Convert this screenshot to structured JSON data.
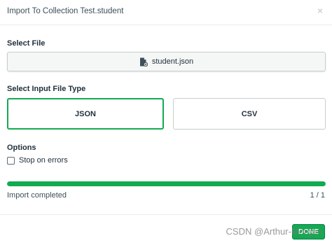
{
  "dialog": {
    "title": "Import To Collection Test.student",
    "close_icon": "×"
  },
  "select_file": {
    "label": "Select File",
    "file_name": "student.json",
    "icon": "file-icon"
  },
  "file_type": {
    "label": "Select Input File Type",
    "options": [
      {
        "label": "JSON",
        "selected": true
      },
      {
        "label": "CSV",
        "selected": false
      }
    ],
    "selected_color": "#13aa52"
  },
  "options": {
    "label": "Options",
    "stop_on_errors": {
      "label": "Stop on errors",
      "checked": false
    }
  },
  "progress": {
    "fraction": 1.0,
    "status": "Import completed",
    "count": "1 / 1",
    "color": "#13aa52"
  },
  "footer": {
    "done_label": "DONE",
    "watermark": "CSDN @Arthur-Morgan"
  }
}
